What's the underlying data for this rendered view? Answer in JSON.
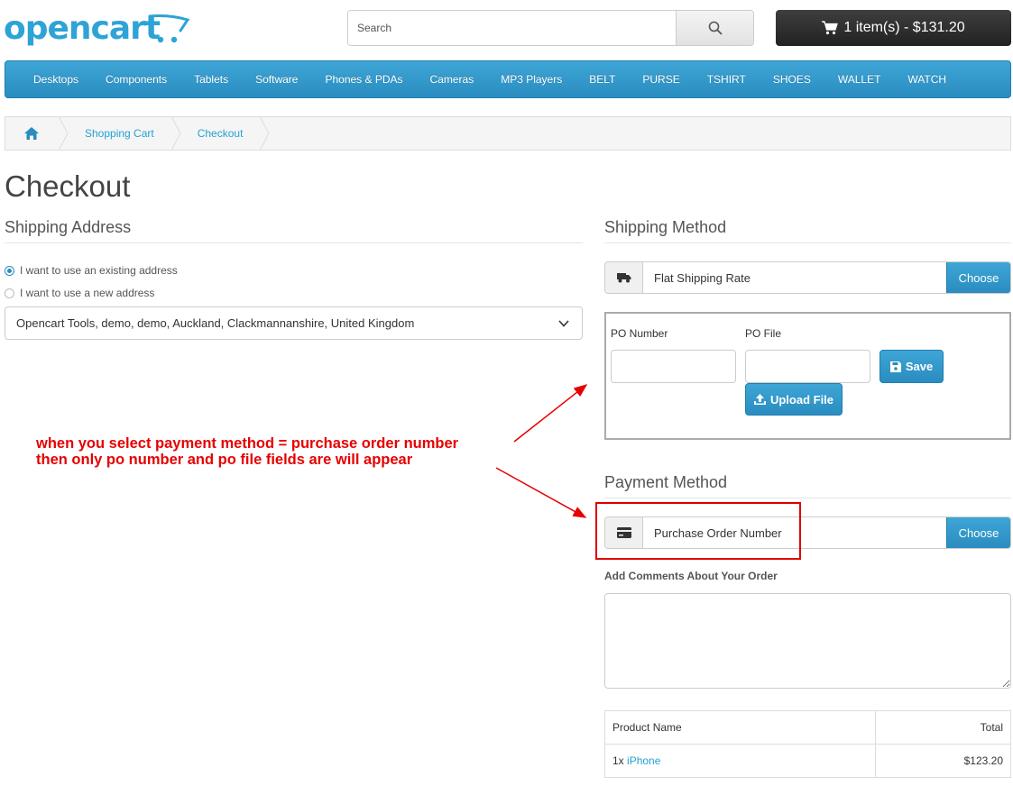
{
  "header": {
    "logo_text": "opencart",
    "search": {
      "placeholder": "Search"
    },
    "cart": {
      "label": "1 item(s) - $131.20"
    }
  },
  "menu": {
    "items": [
      "Desktops",
      "Components",
      "Tablets",
      "Software",
      "Phones & PDAs",
      "Cameras",
      "MP3 Players",
      "BELT",
      "PURSE",
      "TSHIRT",
      "SHOES",
      "WALLET",
      "WATCH"
    ]
  },
  "breadcrumb": {
    "items": [
      "Shopping Cart",
      "Checkout"
    ]
  },
  "page": {
    "title": "Checkout"
  },
  "shipping_address": {
    "title": "Shipping Address",
    "option_existing": "I want to use an existing address",
    "option_new": "I want to use a new address",
    "selected_address": "Opencart Tools, demo, demo, Auckland, Clackmannanshire, United Kingdom"
  },
  "shipping_method": {
    "title": "Shipping Method",
    "value": "Flat Shipping Rate",
    "button": "Choose"
  },
  "po": {
    "number_label": "PO Number",
    "file_label": "PO File",
    "save_button": "Save",
    "upload_button": "Upload File"
  },
  "payment_method": {
    "title": "Payment Method",
    "value": "Purchase Order Number",
    "button": "Choose"
  },
  "comments": {
    "label": "Add Comments About Your Order"
  },
  "order_table": {
    "headers": [
      "Product Name",
      "Total"
    ],
    "rows": [
      {
        "qty": "1x",
        "product": "iPhone",
        "total": "$123.20"
      }
    ]
  },
  "annotation": {
    "line1": "when you select payment method = purchase order number",
    "line2": "then only po number and po file fields are will appear",
    "color": "#e60000"
  },
  "colors": {
    "brand_blue": "#2a8cc0",
    "link": "#23a1d1",
    "dark": "#222222"
  }
}
